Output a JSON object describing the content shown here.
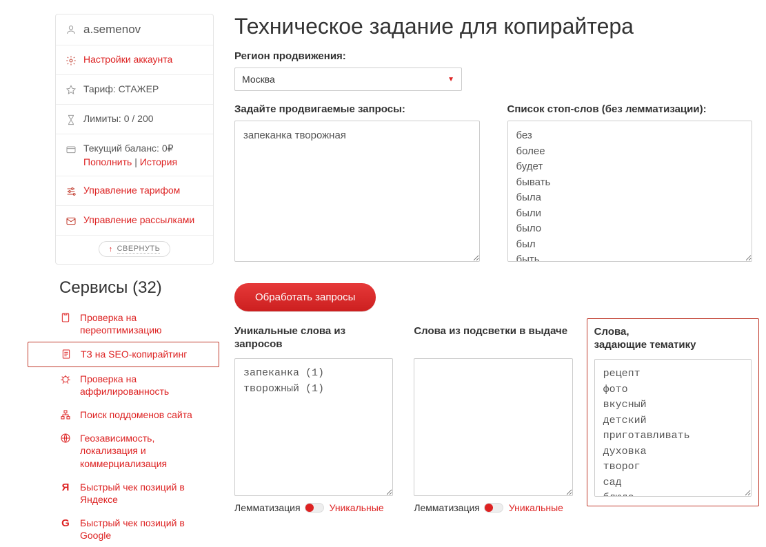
{
  "account": {
    "username": "a.semenov",
    "settings_label": "Настройки аккаунта",
    "tariff_label": "Тариф: СТАЖЕР",
    "limits_label": "Лимиты: 0 / 200",
    "balance_label": "Текущий баланс: 0₽",
    "topup_label": "Пополнить",
    "history_label": "История",
    "manage_tariff_label": "Управление тарифом",
    "manage_mailing_label": "Управление рассылками",
    "collapse_label": "СВЕРНУТЬ"
  },
  "services": {
    "header": "Сервисы (32)",
    "items": [
      "Проверка на переоптимизацию",
      "ТЗ на SEO-копирайтинг",
      "Проверка на аффилированность",
      "Поиск поддоменов сайта",
      "Геозависимость, локализация и коммерциализация",
      "Быстрый чек позиций в Яндексе",
      "Быстрый чек позиций в Google"
    ]
  },
  "main": {
    "title": "Техническое задание для копирайтера",
    "region_label": "Регион продвижения:",
    "region_value": "Москва",
    "queries_label": "Задайте продвигаемые запросы:",
    "queries_value": "запеканка творожная",
    "stopwords_label": "Список стоп-слов (без лемматизации):",
    "stopwords_value": "без\nболее\nбудет\nбывать\nбыла\nбыли\nбыло\nбыл\nбыть",
    "process_btn": "Обработать запросы",
    "unique_label": "Уникальные слова из запросов",
    "unique_value": "запеканка (1)\nтворожный (1)",
    "highlight_label": "Слова из подсветки в выдаче",
    "highlight_value": "",
    "topic_label": "Слова,\nзадающие тематику",
    "topic_value": "рецепт\nфото\nвкусный\nдетский\nприготавливать\ndуховка\nтворог\nсад\nблюдо",
    "topic_value_fixed": "рецепт\nфото\nвкусный\nдетский\nприготавливать\nдуховка\nтворог\nсад\nблюдо",
    "lem_label": "Лемматизация",
    "unique_toggle": "Уникальные"
  }
}
